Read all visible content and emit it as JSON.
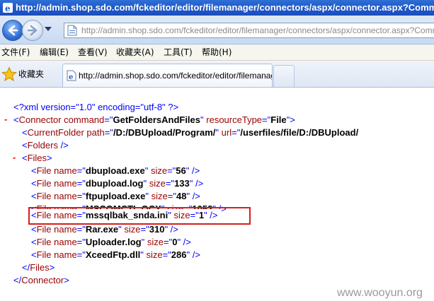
{
  "window": {
    "title": "http://admin.shop.sdo.com/fckeditor/editor/filemanager/connectors/aspx/connector.aspx?Command=G - Wind"
  },
  "navbar": {
    "url": "http://admin.shop.sdo.com/fckeditor/editor/filemanager/connectors/aspx/connector.aspx?Command=G"
  },
  "menu": [
    "文件(F)",
    "编辑(E)",
    "查看(V)",
    "收藏夹(A)",
    "工具(T)",
    "帮助(H)"
  ],
  "favorites": {
    "label": "收藏夹"
  },
  "tab": {
    "label": "http://admin.shop.sdo.com/fckeditor/editor/filemanag..."
  },
  "xml": {
    "declaration": "<?xml version=\"1.0\" encoding=\"utf-8\" ?>",
    "connector": {
      "command": "GetFoldersAndFiles",
      "resourceType": "File"
    },
    "current_folder": {
      "path": "/D:/DBUpload/Program/",
      "url": "/userfiles/file/D:/DBUpload/"
    },
    "files": [
      {
        "name": "dbupload.exe",
        "size": "56"
      },
      {
        "name": "dbupload.log",
        "size": "133"
      },
      {
        "name": "ftpupload.exe",
        "size": "48"
      },
      {
        "name": "MSCOMCTL.OCX",
        "size": "1052"
      },
      {
        "name": "mssqlbak_snda.ini",
        "size": "1",
        "highlighted": true
      },
      {
        "name": "Rar.exe",
        "size": "310"
      },
      {
        "name": "Uploader.log",
        "size": "0"
      },
      {
        "name": "XceedFtp.dll",
        "size": "286"
      }
    ]
  },
  "watermark": "www.wooyun.org",
  "colors": {
    "tag": "#990000",
    "bracket": "#0000ff",
    "highlight_border": "#d61e1e",
    "title_bar": "#1e56c6"
  },
  "icons": [
    "ie-app-icon",
    "back-arrow-icon",
    "forward-arrow-icon",
    "dropdown-arrow-icon",
    "page-icon",
    "favorites-star-icon",
    "tab-ie-icon"
  ]
}
